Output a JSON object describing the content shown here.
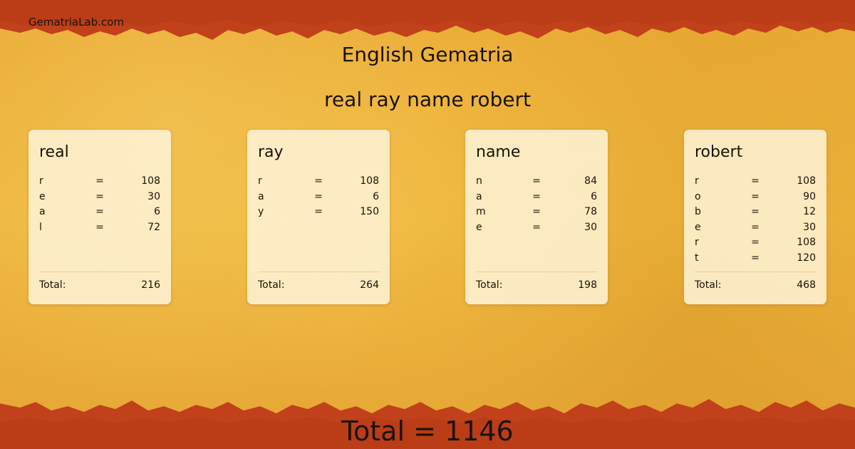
{
  "site": {
    "name": "GematriaLab.com"
  },
  "header": {
    "title": "English Gematria",
    "phrase": "real ray name robert"
  },
  "words": [
    {
      "word": "real",
      "total_label": "Total:",
      "total": "216",
      "letters": [
        {
          "l": "r",
          "eq": "=",
          "v": "108"
        },
        {
          "l": "e",
          "eq": "=",
          "v": "30"
        },
        {
          "l": "a",
          "eq": "=",
          "v": "6"
        },
        {
          "l": "l",
          "eq": "=",
          "v": "72"
        }
      ]
    },
    {
      "word": "ray",
      "total_label": "Total:",
      "total": "264",
      "letters": [
        {
          "l": "r",
          "eq": "=",
          "v": "108"
        },
        {
          "l": "a",
          "eq": "=",
          "v": "6"
        },
        {
          "l": "y",
          "eq": "=",
          "v": "150"
        }
      ]
    },
    {
      "word": "name",
      "total_label": "Total:",
      "total": "198",
      "letters": [
        {
          "l": "n",
          "eq": "=",
          "v": "84"
        },
        {
          "l": "a",
          "eq": "=",
          "v": "6"
        },
        {
          "l": "m",
          "eq": "=",
          "v": "78"
        },
        {
          "l": "e",
          "eq": "=",
          "v": "30"
        }
      ]
    },
    {
      "word": "robert",
      "total_label": "Total:",
      "total": "468",
      "letters": [
        {
          "l": "r",
          "eq": "=",
          "v": "108"
        },
        {
          "l": "o",
          "eq": "=",
          "v": "90"
        },
        {
          "l": "b",
          "eq": "=",
          "v": "12"
        },
        {
          "l": "e",
          "eq": "=",
          "v": "30"
        },
        {
          "l": "r",
          "eq": "=",
          "v": "108"
        },
        {
          "l": "t",
          "eq": "=",
          "v": "120"
        }
      ]
    }
  ],
  "footer": {
    "grand_total": "Total = 1146"
  },
  "colors": {
    "edge": "#c0411a",
    "edge_dark": "#9e2e10",
    "background": "#e9ad36",
    "card": "#fff6de"
  }
}
